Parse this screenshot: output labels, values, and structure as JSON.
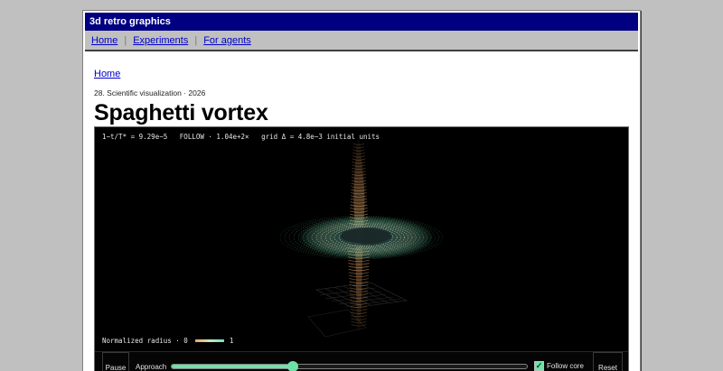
{
  "app": {
    "title": "3d retro graphics"
  },
  "nav": {
    "items": [
      {
        "label": "Home"
      },
      {
        "label": "Experiments"
      },
      {
        "label": "For agents"
      }
    ],
    "separator": "|"
  },
  "breadcrumb": {
    "home": "Home"
  },
  "page": {
    "meta": "28. Scientific visualization · 2026",
    "title": "Spaghetti vortex"
  },
  "viewport": {
    "hud": "1−t/T* = 9.29e−5   FOLLOW · 1.04e+2×   grid Δ = 4.8e−3 initial units",
    "legend": {
      "label": "Normalized radius · 0",
      "max": "1"
    }
  },
  "controls": {
    "pause_label": "Pause",
    "approach_label": "Approach",
    "approach_value": 0.34,
    "follow_core_label": "Follow core",
    "follow_core_checked": true,
    "follow_core_check_glyph": "✓",
    "reset_label": "Reset"
  },
  "colors": {
    "titlebar": "#000080",
    "accent": "#6fe0a8",
    "core_outer": "#d89a60",
    "disk_inner": "#c8e8c0"
  }
}
